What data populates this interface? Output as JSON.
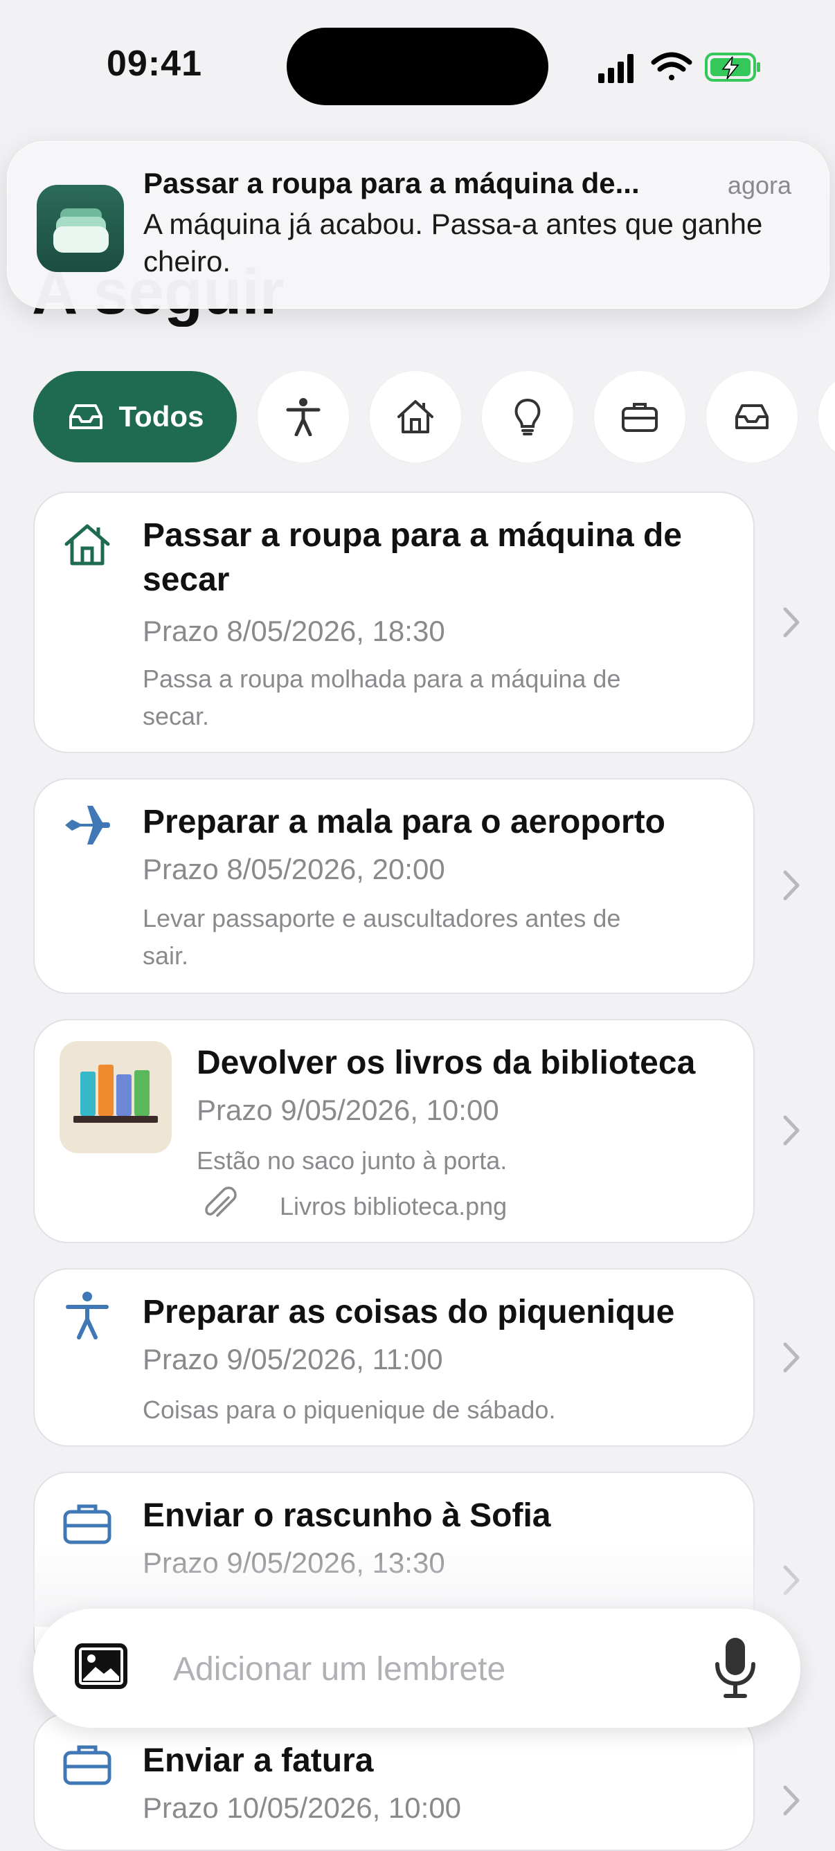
{
  "status_bar": {
    "time": "09:41",
    "icons": [
      "signal-icon",
      "wifi-icon",
      "battery-charging-icon"
    ]
  },
  "page": {
    "title": "A seguir"
  },
  "notification": {
    "title": "Passar a roupa para a máquina de...",
    "time": "agora",
    "body": "A máquina já acabou. Passa-a antes que ganhe cheiro.",
    "app_icon": "stack-icon"
  },
  "filters": [
    {
      "label": "Todos",
      "icon": "tray-icon",
      "selected": true
    },
    {
      "label": "",
      "icon": "accessibility-icon"
    },
    {
      "label": "",
      "icon": "home-icon"
    },
    {
      "label": "",
      "icon": "lightbulb-icon"
    },
    {
      "label": "",
      "icon": "briefcase-icon"
    },
    {
      "label": "",
      "icon": "tray-icon"
    }
  ],
  "reminders": [
    {
      "title": "Passar a roupa para a máquina de secar",
      "due": "Prazo 8/05/2026, 18:30",
      "description": "Passa a roupa molhada para a máquina de secar.",
      "icon": "home-icon"
    },
    {
      "title": "Preparar a mala para o aeroporto",
      "due": "Prazo 8/05/2026, 20:00",
      "description": "Levar passaporte e auscultadores antes de sair.",
      "icon": "airplane-icon"
    },
    {
      "title": "Devolver os livros da biblioteca",
      "due": "Prazo 9/05/2026, 10:00",
      "description": "Estão no saco junto à porta.",
      "attachment": "Livros biblioteca.png",
      "icon": "books-thumbnail"
    },
    {
      "title": "Preparar as coisas do piquenique",
      "due": "Prazo 9/05/2026, 11:00",
      "description": "Coisas para o piquenique de sábado.",
      "icon": "accessibility-icon"
    },
    {
      "title": "Enviar o rascunho à Sofia",
      "due": "Prazo 9/05/2026, 13:30",
      "description": "",
      "icon": "briefcase-icon"
    },
    {
      "title": "Enviar a fatura",
      "due": "Prazo 10/05/2026, 10:00",
      "description": "",
      "icon": "briefcase-icon"
    }
  ],
  "composer": {
    "placeholder": "Adicionar um lembrete"
  },
  "colors": {
    "accent": "#1f6b51",
    "blue_icon": "#3f78b4",
    "secondary_text": "#8a8a8e"
  }
}
